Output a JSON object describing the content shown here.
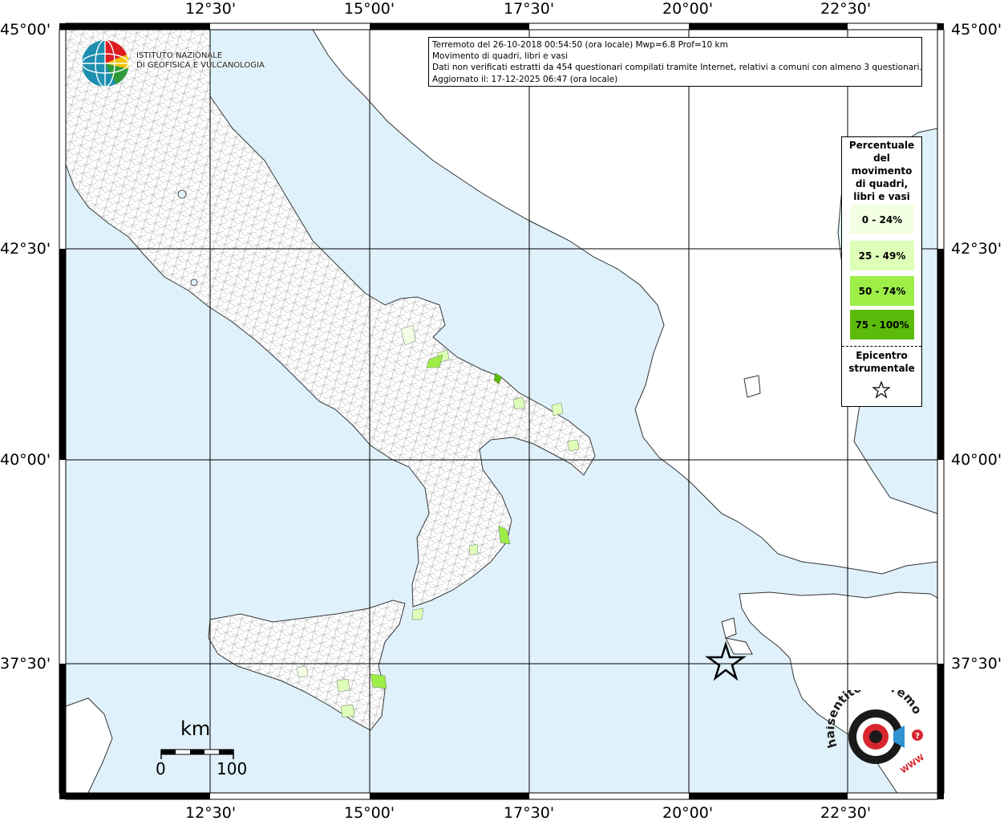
{
  "map": {
    "lon_labels": [
      "12°30'",
      "15°00'",
      "17°30'",
      "20°00'",
      "22°30'"
    ],
    "lat_labels": [
      "45°00'",
      "42°30'",
      "40°00'",
      "37°30'"
    ],
    "colors": {
      "sea": "#dff1fb",
      "land": "#ffffff",
      "class_0_24": "#f2ffe2",
      "class_25_49": "#ddffb8",
      "class_50_74": "#9dee47",
      "class_75_100": "#5cbb0a"
    }
  },
  "info": {
    "line1": "Terremoto del 26-10-2018 00:54:50 (ora locale) Mwp=6.8 Prof=10 km",
    "line2": "Movimento di quadri, libri e vasi",
    "line3": "Dati non verificati estratti da 454 questionari compilati tramite Internet, relativi a comuni con almeno 3 questionari.",
    "line4": "Aggiornato il: 17-12-2025 06:47 (ora locale)"
  },
  "legend": {
    "title_lines": [
      "Percentuale",
      "del",
      "movimento",
      "di quadri,",
      "libri e vasi"
    ],
    "classes": [
      {
        "label": "0 - 24%",
        "color": "#f2ffe2"
      },
      {
        "label": "25 - 49%",
        "color": "#ddffb8"
      },
      {
        "label": "50 - 74%",
        "color": "#9dee47"
      },
      {
        "label": "75 - 100%",
        "color": "#5cbb0a"
      }
    ],
    "epicenter_lines": [
      "Epicentro",
      "strumentale"
    ]
  },
  "logo": {
    "ingv_line1": "ISTITUTO NAZIONALE",
    "ingv_line2": "DI GEOFISICA E VULCANOLOGIA",
    "haisentito_text": "haisentitoilterremoto.it",
    "haisentito_www": "WWW",
    "haisentito_q": "?"
  },
  "scale": {
    "unit": "km",
    "start": "0",
    "end": "100"
  }
}
